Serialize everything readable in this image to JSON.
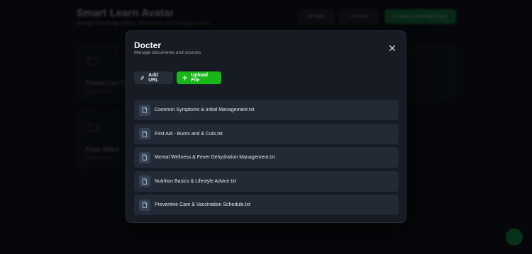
{
  "background": {
    "title": "Smart Learn Avatar",
    "subtitle": "Manage knowledge folders, documents and learning content",
    "buttons": [
      {
        "label": "AI Voice"
      },
      {
        "label": "AI Help"
      },
      {
        "label": "Create Knowledge Base"
      }
    ],
    "cards": [
      {
        "name": "Primary Care Tips",
        "meta": "5 documents"
      },
      {
        "name": "Public Affairs",
        "meta": "2 documents"
      }
    ]
  },
  "modal": {
    "title": "Docter",
    "subtitle": "Manage documents and sources",
    "close_icon": "close-icon",
    "add_url_label": "Add URL",
    "upload_label": "Upload File",
    "accent_color": "#16b716",
    "files": [
      {
        "name": "Common Symptoms & Initial Management.txt"
      },
      {
        "name": "First Aid - Burns and & Cuts.txt"
      },
      {
        "name": "Mental Wellness & Fever Dehydration Management.txt"
      },
      {
        "name": "Nutrition Basics & Lifestyle Advice.txt"
      },
      {
        "name": "Preventive Care & Vaccination Schedule.txt"
      }
    ]
  }
}
